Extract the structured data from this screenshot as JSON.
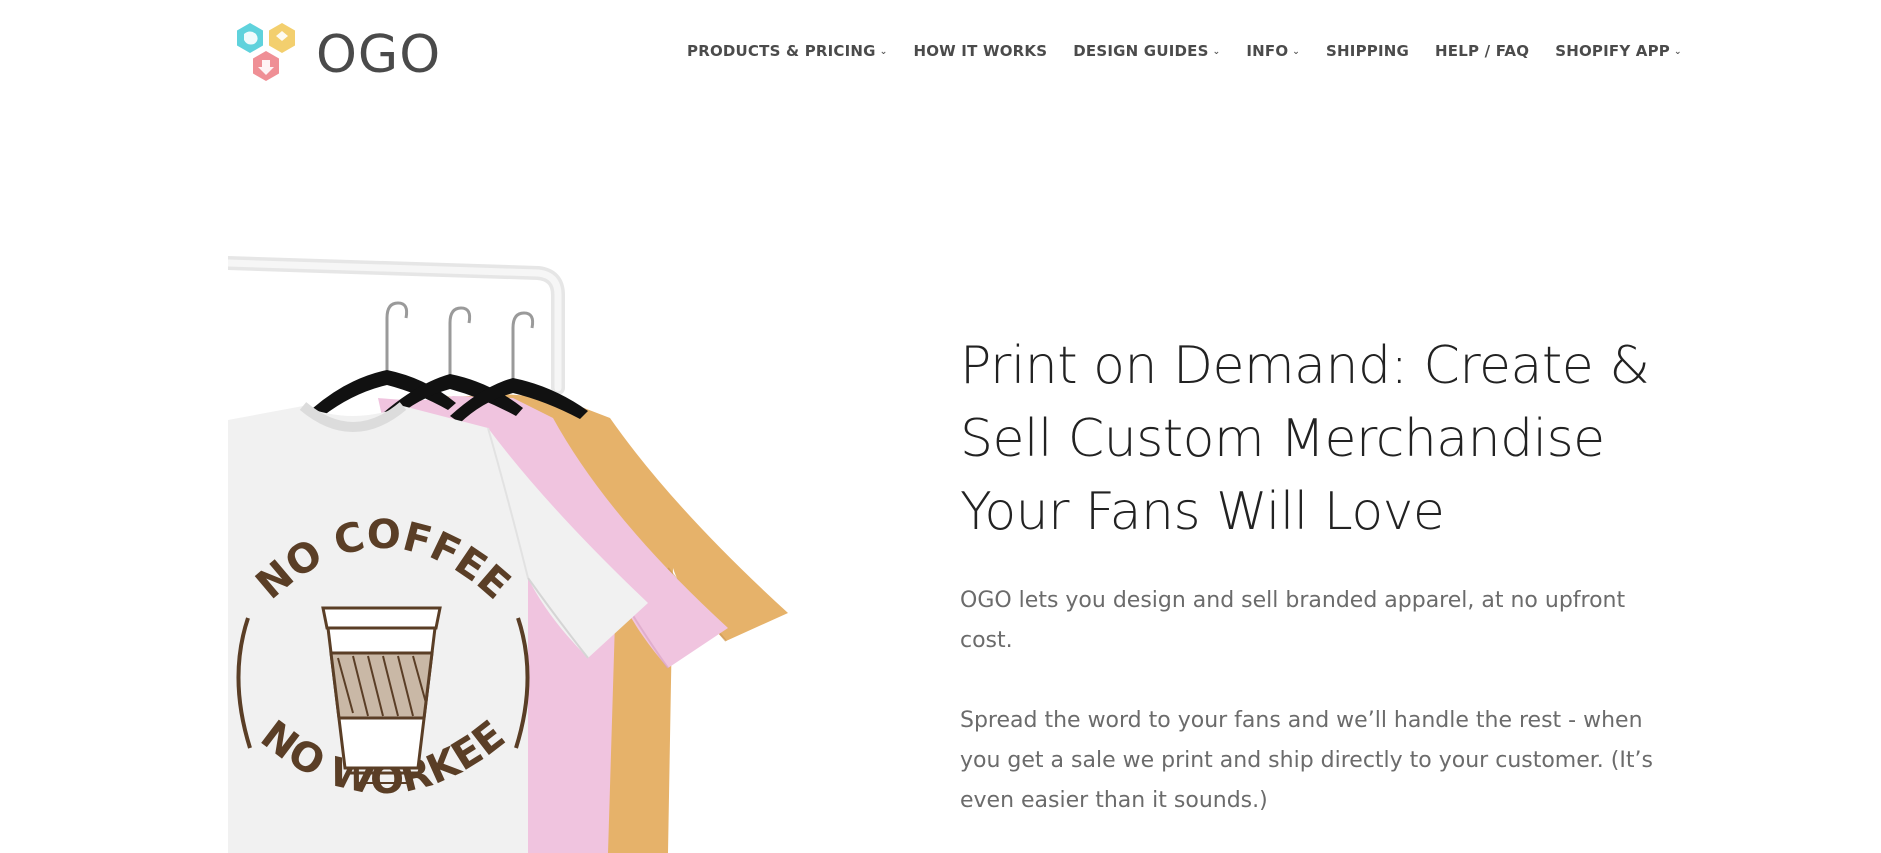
{
  "brand": {
    "logo_text": "OGO"
  },
  "nav": {
    "items": [
      {
        "label": "PRODUCTS & PRICING",
        "dropdown": true
      },
      {
        "label": "HOW IT WORKS",
        "dropdown": false
      },
      {
        "label": "DESIGN GUIDES",
        "dropdown": true
      },
      {
        "label": "INFO",
        "dropdown": true
      },
      {
        "label": "SHIPPING",
        "dropdown": false
      },
      {
        "label": "HELP / FAQ",
        "dropdown": false
      },
      {
        "label": "SHOPIFY APP",
        "dropdown": true
      }
    ],
    "chevron": "⌄"
  },
  "hero": {
    "title": "Print on Demand: Create & Sell Custom Merchandise Your Fans Will Love",
    "paragraph1": "OGO lets you design and sell branded apparel, at no upfront cost.",
    "paragraph2": "Spread the word to your fans and we’ll handle the rest - when you get a sale we print and ship directly to your customer. (It’s even easier than it sounds.)",
    "image": {
      "shirt_text_top": "NO COFFEE",
      "shirt_text_bottom": "NO WORKEE"
    }
  },
  "colors": {
    "logo_teal": "#5fd2dc",
    "logo_yellow": "#f3cf6e",
    "logo_pink": "#ef8f95",
    "shirt_white": "#f1f1f1",
    "shirt_pink": "#f0c4df",
    "shirt_mustard": "#e6b26a",
    "print_brown": "#5a3e26"
  }
}
